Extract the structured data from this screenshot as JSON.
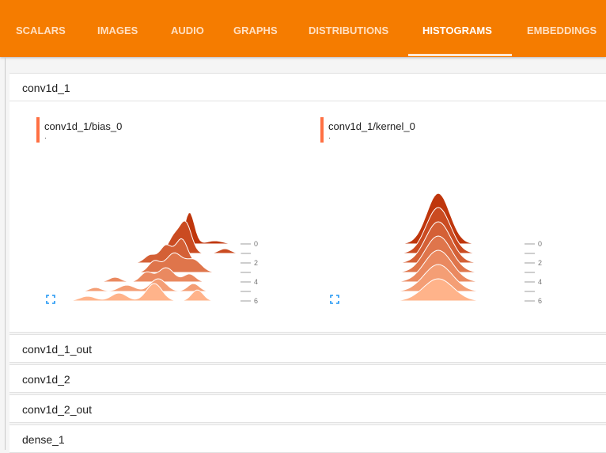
{
  "tabs": [
    {
      "label": "SCALARS",
      "active": false
    },
    {
      "label": "IMAGES",
      "active": false
    },
    {
      "label": "AUDIO",
      "active": false
    },
    {
      "label": "GRAPHS",
      "active": false
    },
    {
      "label": "DISTRIBUTIONS",
      "active": false
    },
    {
      "label": "HISTOGRAMS",
      "active": true
    },
    {
      "label": "EMBEDDINGS",
      "active": false
    }
  ],
  "colors": {
    "header": "#f57c00",
    "run_marker": "#ff7043",
    "hist_light": "#ffb38a",
    "hist_dark": "#bf360c"
  },
  "groups": [
    {
      "name": "conv1d_1",
      "expanded": true
    },
    {
      "name": "conv1d_1_out",
      "expanded": false
    },
    {
      "name": "conv1d_2",
      "expanded": false
    },
    {
      "name": "conv1d_2_out",
      "expanded": false
    },
    {
      "name": "dense_1",
      "expanded": false
    }
  ],
  "cards": [
    {
      "title": "conv1d_1/bias_0",
      "subtitle": ".",
      "expand_icon": "fullscreen-icon"
    },
    {
      "title": "conv1d_1/kernel_0",
      "subtitle": ".",
      "expand_icon": "fullscreen-icon"
    }
  ],
  "chart_data": [
    {
      "type": "area",
      "title": "conv1d_1/bias_0",
      "x_ticks": [
        "-0.06",
        "-0.04",
        "-0.02",
        "0.00",
        "0.02"
      ],
      "xlim": [
        -0.06,
        0.028
      ],
      "step_ticks": [
        "0",
        "2",
        "4",
        "6"
      ],
      "steps": [
        0,
        1,
        2,
        3,
        4,
        5,
        6
      ],
      "series": [
        {
          "step": 0,
          "peaks": [
            [
              0.002,
              40,
              0.0025
            ],
            [
              0.015,
              4,
              0.004
            ]
          ]
        },
        {
          "step": 1,
          "peaks": [
            [
              0.0,
              38,
              0.003
            ],
            [
              -0.006,
              20,
              0.003
            ],
            [
              0.02,
              6,
              0.003
            ]
          ]
        },
        {
          "step": 2,
          "peaks": [
            [
              -0.002,
              30,
              0.003
            ],
            [
              -0.01,
              22,
              0.003
            ],
            [
              -0.018,
              10,
              0.003
            ]
          ]
        },
        {
          "step": 3,
          "peaks": [
            [
              -0.006,
              24,
              0.004
            ],
            [
              -0.016,
              14,
              0.003
            ],
            [
              0.004,
              16,
              0.004
            ]
          ]
        },
        {
          "step": 4,
          "peaks": [
            [
              -0.01,
              18,
              0.004
            ],
            [
              -0.02,
              12,
              0.003
            ],
            [
              0.002,
              10,
              0.003
            ],
            [
              -0.036,
              6,
              0.003
            ]
          ]
        },
        {
          "step": 5,
          "peaks": [
            [
              -0.014,
              16,
              0.004
            ],
            [
              0.004,
              10,
              0.003
            ],
            [
              -0.03,
              8,
              0.004
            ],
            [
              -0.046,
              5,
              0.003
            ]
          ]
        },
        {
          "step": 6,
          "peaks": [
            [
              -0.016,
              22,
              0.004
            ],
            [
              0.006,
              14,
              0.003
            ],
            [
              -0.034,
              10,
              0.004
            ],
            [
              -0.05,
              6,
              0.004
            ]
          ]
        }
      ]
    },
    {
      "type": "area",
      "title": "conv1d_1/kernel_0",
      "x_ticks": [
        "-0.15",
        "-0.05",
        "0.05",
        "0.15"
      ],
      "xlim": [
        -0.15,
        0.15
      ],
      "step_ticks": [
        "0",
        "2",
        "4",
        "6"
      ],
      "steps": [
        0,
        1,
        2,
        3,
        4,
        5,
        6
      ],
      "series": [
        {
          "step": 0,
          "peaks": [
            [
              0.0,
              64,
              0.02
            ]
          ]
        },
        {
          "step": 1,
          "peaks": [
            [
              0.0,
              58,
              0.021
            ]
          ]
        },
        {
          "step": 2,
          "peaks": [
            [
              0.0,
              52,
              0.022
            ]
          ]
        },
        {
          "step": 3,
          "peaks": [
            [
              0.0,
              46,
              0.023
            ]
          ]
        },
        {
          "step": 4,
          "peaks": [
            [
              0.0,
              40,
              0.024
            ]
          ]
        },
        {
          "step": 5,
          "peaks": [
            [
              0.0,
              34,
              0.025
            ]
          ]
        },
        {
          "step": 6,
          "peaks": [
            [
              0.0,
              28,
              0.026
            ]
          ]
        }
      ]
    }
  ]
}
